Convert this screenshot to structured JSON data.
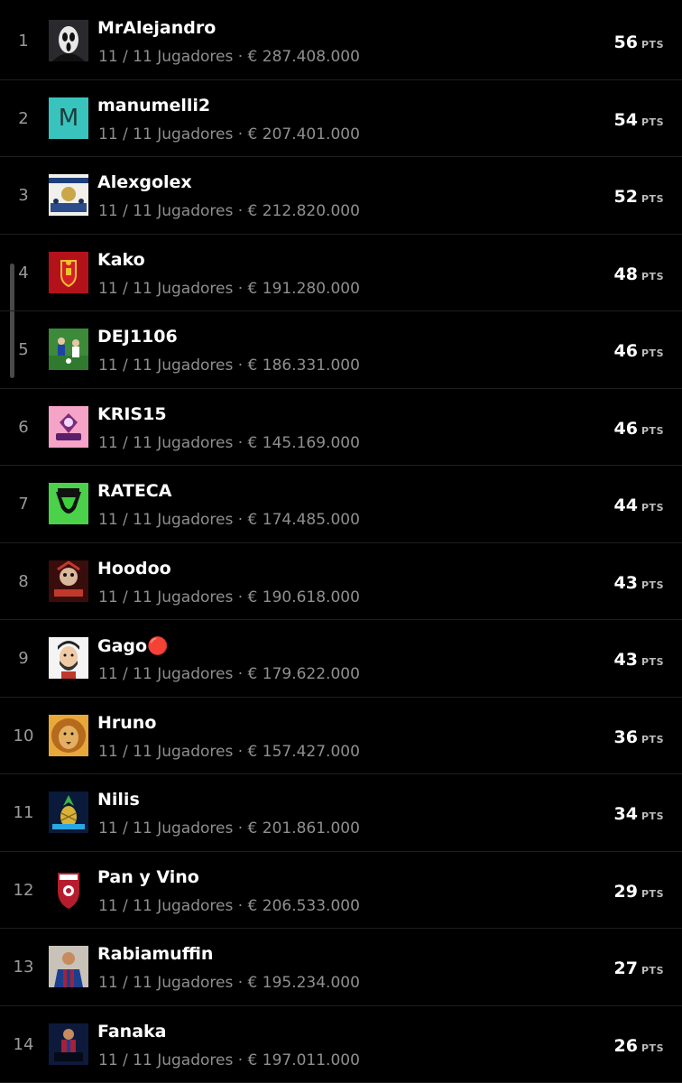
{
  "points_unit": "PTS",
  "rows": [
    {
      "rank": "1",
      "name": "MrAlejandro",
      "meta": "11 / 11 Jugadores · € 287.408.000",
      "points": "56",
      "avatar": "ghostface-avatar"
    },
    {
      "rank": "2",
      "name": "manumelli2",
      "meta": "11 / 11 Jugadores · € 207.401.000",
      "points": "54",
      "avatar": "letter-avatar",
      "avatar_letter": "M"
    },
    {
      "rank": "3",
      "name": "Alexgolex",
      "meta": "11 / 11 Jugadores · € 212.820.000",
      "points": "52",
      "avatar": "team-photo-avatar"
    },
    {
      "rank": "4",
      "name": "Kako",
      "meta": "11 / 11 Jugadores · € 191.280.000",
      "points": "48",
      "avatar": "spain-crest-avatar"
    },
    {
      "rank": "5",
      "name": "DEJ1106",
      "meta": "11 / 11 Jugadores · € 186.331.000",
      "points": "46",
      "avatar": "players-photo-avatar"
    },
    {
      "rank": "6",
      "name": "KRIS15",
      "meta": "11 / 11 Jugadores · € 145.169.000",
      "points": "46",
      "avatar": "kris-logo-avatar"
    },
    {
      "rank": "7",
      "name": "RATECA",
      "meta": "11 / 11 Jugadores · € 174.485.000",
      "points": "44",
      "avatar": "green-logo-avatar"
    },
    {
      "rank": "8",
      "name": "Hoodoo",
      "meta": "11 / 11 Jugadores · € 190.618.000",
      "points": "43",
      "avatar": "hoodoo-logo-avatar"
    },
    {
      "rank": "9",
      "name": "Gago🔴",
      "meta": "11 / 11 Jugadores · € 179.622.000",
      "points": "43",
      "avatar": "cartoon-man-avatar"
    },
    {
      "rank": "10",
      "name": "Hruno",
      "meta": "11 / 11 Jugadores · € 157.427.000",
      "points": "36",
      "avatar": "lion-avatar"
    },
    {
      "rank": "11",
      "name": "Nilis",
      "meta": "11 / 11 Jugadores · € 201.861.000",
      "points": "34",
      "avatar": "pineapple-avatar"
    },
    {
      "rank": "12",
      "name": "Pan y Vino",
      "meta": "11 / 11 Jugadores · € 206.533.000",
      "points": "29",
      "avatar": "crest-avatar"
    },
    {
      "rank": "13",
      "name": "Rabiamuffin",
      "meta": "11 / 11 Jugadores · € 195.234.000",
      "points": "27",
      "avatar": "player-photo-avatar"
    },
    {
      "rank": "14",
      "name": "Fanaka",
      "meta": "11 / 11 Jugadores · € 197.011.000",
      "points": "26",
      "avatar": "dios-photo-avatar"
    }
  ]
}
